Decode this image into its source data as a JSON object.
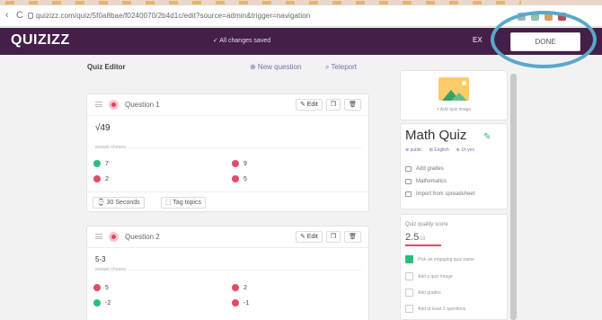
{
  "browser": {
    "back_label": "‹",
    "reload_label": "C",
    "url": "quizizz.com/quiz/5f0a8bae/f0240070/2b4d1c/edit?source=admin&trigger=navigation"
  },
  "header": {
    "logo": "QUIZIZZ",
    "saved_status": "✓ All changes saved",
    "exit_label": "EX",
    "done_label": "DONE"
  },
  "editor": {
    "title": "Quiz Editor",
    "new_question": "⊕ New question",
    "teleport": "⌕ Teleport"
  },
  "questions": [
    {
      "label": "Question 1",
      "text": "√49",
      "answers_label": "answer choices",
      "answers": [
        {
          "text": "7",
          "correct": true
        },
        {
          "text": "9",
          "correct": false
        },
        {
          "text": "2",
          "correct": false
        },
        {
          "text": "5",
          "correct": false
        }
      ],
      "time": "⌚ 30 Seconds",
      "tag": "⬚ Tag topics",
      "edit_label": "✎ Edit"
    },
    {
      "label": "Question 2",
      "text": "5-3",
      "answers_label": "answer choices",
      "answers": [
        {
          "text": "5",
          "correct": false
        },
        {
          "text": "2",
          "correct": false
        },
        {
          "text": "-2",
          "correct": true
        },
        {
          "text": "-1",
          "correct": false
        }
      ],
      "edit_label": "✎ Edit"
    }
  ],
  "sidebar": {
    "add_image": "+ Add quiz image",
    "quiz_name": "Math Quiz",
    "meta": [
      "⊕ public",
      "⊞ English",
      "⊕ 1h yes"
    ],
    "links": [
      "Add grades",
      "Mathematics",
      "Import from spreadsheet"
    ],
    "quality_title": "Quiz quality score",
    "quality_score": "2.5",
    "quality_max": "/10",
    "checklist": [
      {
        "label": "Pick an engaging quiz name",
        "done": true
      },
      {
        "label": "Add a quiz image",
        "done": false
      },
      {
        "label": "Add grades",
        "done": false
      },
      {
        "label": "Add at least 3 questions",
        "done": false
      }
    ]
  },
  "colors": {
    "header": "#441f48",
    "correct": "#2bbd7e",
    "wrong": "#e24b67",
    "accent": "#7b6da8",
    "highlight_ring": "#5aa8c8"
  }
}
